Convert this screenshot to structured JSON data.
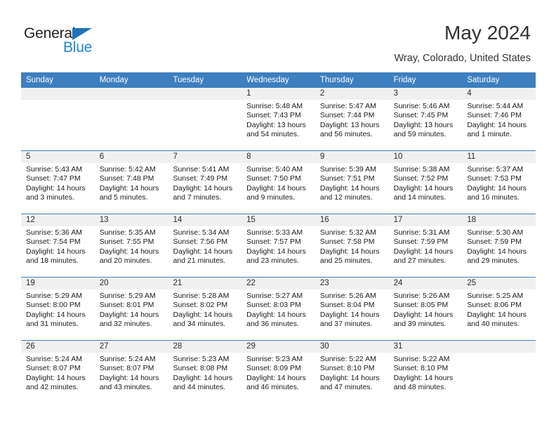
{
  "brand": {
    "name_part1": "General",
    "name_part2": "Blue",
    "accent_color": "#1f86d0",
    "triangle_color": "#1f73b8"
  },
  "header": {
    "title": "May 2024",
    "subtitle": "Wray, Colorado, United States"
  },
  "calendar": {
    "header_bg": "#3d7fbf",
    "daynum_bg": "#f0f0f0",
    "weekdays": [
      "Sunday",
      "Monday",
      "Tuesday",
      "Wednesday",
      "Thursday",
      "Friday",
      "Saturday"
    ],
    "weeks": [
      {
        "days": [
          {
            "num": "",
            "sunrise": "",
            "sunset": "",
            "daylight_line1": "",
            "daylight_line2": ""
          },
          {
            "num": "",
            "sunrise": "",
            "sunset": "",
            "daylight_line1": "",
            "daylight_line2": ""
          },
          {
            "num": "",
            "sunrise": "",
            "sunset": "",
            "daylight_line1": "",
            "daylight_line2": ""
          },
          {
            "num": "1",
            "sunrise": "Sunrise: 5:48 AM",
            "sunset": "Sunset: 7:43 PM",
            "daylight_line1": "Daylight: 13 hours",
            "daylight_line2": "and 54 minutes."
          },
          {
            "num": "2",
            "sunrise": "Sunrise: 5:47 AM",
            "sunset": "Sunset: 7:44 PM",
            "daylight_line1": "Daylight: 13 hours",
            "daylight_line2": "and 56 minutes."
          },
          {
            "num": "3",
            "sunrise": "Sunrise: 5:46 AM",
            "sunset": "Sunset: 7:45 PM",
            "daylight_line1": "Daylight: 13 hours",
            "daylight_line2": "and 59 minutes."
          },
          {
            "num": "4",
            "sunrise": "Sunrise: 5:44 AM",
            "sunset": "Sunset: 7:46 PM",
            "daylight_line1": "Daylight: 14 hours",
            "daylight_line2": "and 1 minute."
          }
        ]
      },
      {
        "days": [
          {
            "num": "5",
            "sunrise": "Sunrise: 5:43 AM",
            "sunset": "Sunset: 7:47 PM",
            "daylight_line1": "Daylight: 14 hours",
            "daylight_line2": "and 3 minutes."
          },
          {
            "num": "6",
            "sunrise": "Sunrise: 5:42 AM",
            "sunset": "Sunset: 7:48 PM",
            "daylight_line1": "Daylight: 14 hours",
            "daylight_line2": "and 5 minutes."
          },
          {
            "num": "7",
            "sunrise": "Sunrise: 5:41 AM",
            "sunset": "Sunset: 7:49 PM",
            "daylight_line1": "Daylight: 14 hours",
            "daylight_line2": "and 7 minutes."
          },
          {
            "num": "8",
            "sunrise": "Sunrise: 5:40 AM",
            "sunset": "Sunset: 7:50 PM",
            "daylight_line1": "Daylight: 14 hours",
            "daylight_line2": "and 9 minutes."
          },
          {
            "num": "9",
            "sunrise": "Sunrise: 5:39 AM",
            "sunset": "Sunset: 7:51 PM",
            "daylight_line1": "Daylight: 14 hours",
            "daylight_line2": "and 12 minutes."
          },
          {
            "num": "10",
            "sunrise": "Sunrise: 5:38 AM",
            "sunset": "Sunset: 7:52 PM",
            "daylight_line1": "Daylight: 14 hours",
            "daylight_line2": "and 14 minutes."
          },
          {
            "num": "11",
            "sunrise": "Sunrise: 5:37 AM",
            "sunset": "Sunset: 7:53 PM",
            "daylight_line1": "Daylight: 14 hours",
            "daylight_line2": "and 16 minutes."
          }
        ]
      },
      {
        "days": [
          {
            "num": "12",
            "sunrise": "Sunrise: 5:36 AM",
            "sunset": "Sunset: 7:54 PM",
            "daylight_line1": "Daylight: 14 hours",
            "daylight_line2": "and 18 minutes."
          },
          {
            "num": "13",
            "sunrise": "Sunrise: 5:35 AM",
            "sunset": "Sunset: 7:55 PM",
            "daylight_line1": "Daylight: 14 hours",
            "daylight_line2": "and 20 minutes."
          },
          {
            "num": "14",
            "sunrise": "Sunrise: 5:34 AM",
            "sunset": "Sunset: 7:56 PM",
            "daylight_line1": "Daylight: 14 hours",
            "daylight_line2": "and 21 minutes."
          },
          {
            "num": "15",
            "sunrise": "Sunrise: 5:33 AM",
            "sunset": "Sunset: 7:57 PM",
            "daylight_line1": "Daylight: 14 hours",
            "daylight_line2": "and 23 minutes."
          },
          {
            "num": "16",
            "sunrise": "Sunrise: 5:32 AM",
            "sunset": "Sunset: 7:58 PM",
            "daylight_line1": "Daylight: 14 hours",
            "daylight_line2": "and 25 minutes."
          },
          {
            "num": "17",
            "sunrise": "Sunrise: 5:31 AM",
            "sunset": "Sunset: 7:59 PM",
            "daylight_line1": "Daylight: 14 hours",
            "daylight_line2": "and 27 minutes."
          },
          {
            "num": "18",
            "sunrise": "Sunrise: 5:30 AM",
            "sunset": "Sunset: 7:59 PM",
            "daylight_line1": "Daylight: 14 hours",
            "daylight_line2": "and 29 minutes."
          }
        ]
      },
      {
        "days": [
          {
            "num": "19",
            "sunrise": "Sunrise: 5:29 AM",
            "sunset": "Sunset: 8:00 PM",
            "daylight_line1": "Daylight: 14 hours",
            "daylight_line2": "and 31 minutes."
          },
          {
            "num": "20",
            "sunrise": "Sunrise: 5:29 AM",
            "sunset": "Sunset: 8:01 PM",
            "daylight_line1": "Daylight: 14 hours",
            "daylight_line2": "and 32 minutes."
          },
          {
            "num": "21",
            "sunrise": "Sunrise: 5:28 AM",
            "sunset": "Sunset: 8:02 PM",
            "daylight_line1": "Daylight: 14 hours",
            "daylight_line2": "and 34 minutes."
          },
          {
            "num": "22",
            "sunrise": "Sunrise: 5:27 AM",
            "sunset": "Sunset: 8:03 PM",
            "daylight_line1": "Daylight: 14 hours",
            "daylight_line2": "and 36 minutes."
          },
          {
            "num": "23",
            "sunrise": "Sunrise: 5:26 AM",
            "sunset": "Sunset: 8:04 PM",
            "daylight_line1": "Daylight: 14 hours",
            "daylight_line2": "and 37 minutes."
          },
          {
            "num": "24",
            "sunrise": "Sunrise: 5:26 AM",
            "sunset": "Sunset: 8:05 PM",
            "daylight_line1": "Daylight: 14 hours",
            "daylight_line2": "and 39 minutes."
          },
          {
            "num": "25",
            "sunrise": "Sunrise: 5:25 AM",
            "sunset": "Sunset: 8:06 PM",
            "daylight_line1": "Daylight: 14 hours",
            "daylight_line2": "and 40 minutes."
          }
        ]
      },
      {
        "days": [
          {
            "num": "26",
            "sunrise": "Sunrise: 5:24 AM",
            "sunset": "Sunset: 8:07 PM",
            "daylight_line1": "Daylight: 14 hours",
            "daylight_line2": "and 42 minutes."
          },
          {
            "num": "27",
            "sunrise": "Sunrise: 5:24 AM",
            "sunset": "Sunset: 8:07 PM",
            "daylight_line1": "Daylight: 14 hours",
            "daylight_line2": "and 43 minutes."
          },
          {
            "num": "28",
            "sunrise": "Sunrise: 5:23 AM",
            "sunset": "Sunset: 8:08 PM",
            "daylight_line1": "Daylight: 14 hours",
            "daylight_line2": "and 44 minutes."
          },
          {
            "num": "29",
            "sunrise": "Sunrise: 5:23 AM",
            "sunset": "Sunset: 8:09 PM",
            "daylight_line1": "Daylight: 14 hours",
            "daylight_line2": "and 46 minutes."
          },
          {
            "num": "30",
            "sunrise": "Sunrise: 5:22 AM",
            "sunset": "Sunset: 8:10 PM",
            "daylight_line1": "Daylight: 14 hours",
            "daylight_line2": "and 47 minutes."
          },
          {
            "num": "31",
            "sunrise": "Sunrise: 5:22 AM",
            "sunset": "Sunset: 8:10 PM",
            "daylight_line1": "Daylight: 14 hours",
            "daylight_line2": "and 48 minutes."
          },
          {
            "num": "",
            "sunrise": "",
            "sunset": "",
            "daylight_line1": "",
            "daylight_line2": ""
          }
        ]
      }
    ]
  }
}
